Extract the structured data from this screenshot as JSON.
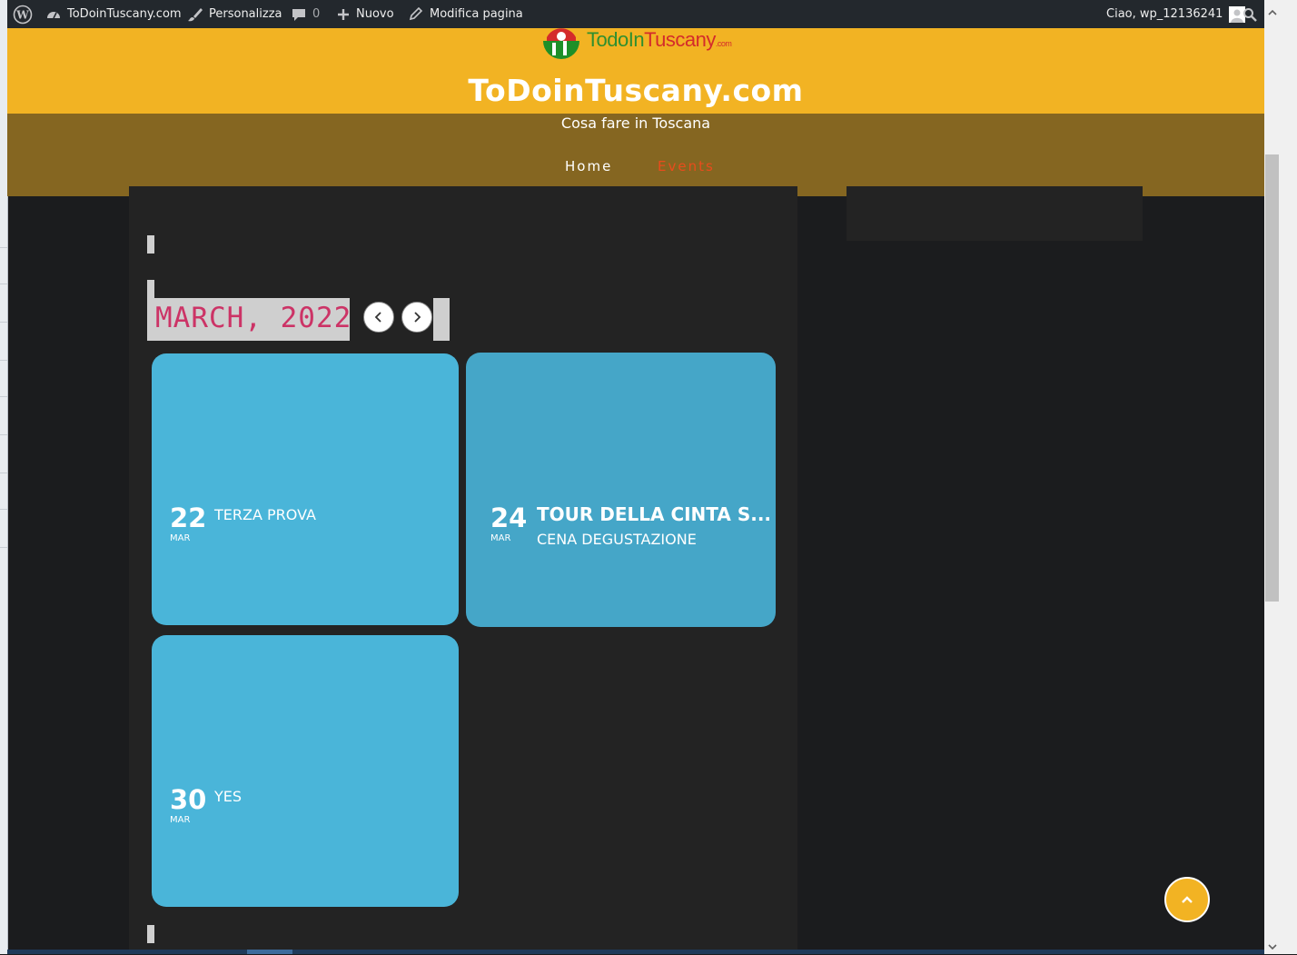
{
  "adminbar": {
    "site_name": "ToDoinTuscany.com",
    "customize": "Personalizza",
    "comments_count": "0",
    "new_label": "Nuovo",
    "edit_page": "Modifica pagina",
    "greeting": "Ciao, wp_12136241"
  },
  "logo": {
    "text_todo": "TodoIn",
    "text_tuscany": "Tuscany",
    "text_com": ".com"
  },
  "site": {
    "title": "ToDoinTuscany.com",
    "tagline": "Cosa fare in Toscana"
  },
  "nav": {
    "items": [
      {
        "label": "Home"
      },
      {
        "label": "Events"
      }
    ]
  },
  "calendar": {
    "month_label": "MARCH, 2022"
  },
  "events": [
    {
      "day": "22",
      "month": "MAR",
      "title": "TERZA PROVA",
      "subtitle": ""
    },
    {
      "day": "24",
      "month": "MAR",
      "title": "TOUR DELLA CINTA S...",
      "subtitle": "CENA DEGUSTAZIONE"
    },
    {
      "day": "30",
      "month": "MAR",
      "title": "YES",
      "subtitle": ""
    }
  ],
  "colors": {
    "header_yellow": "#f2b323",
    "nav_active": "#e84c1c",
    "card_blue": "#4ab5d9",
    "month_pink": "#cc3366"
  }
}
